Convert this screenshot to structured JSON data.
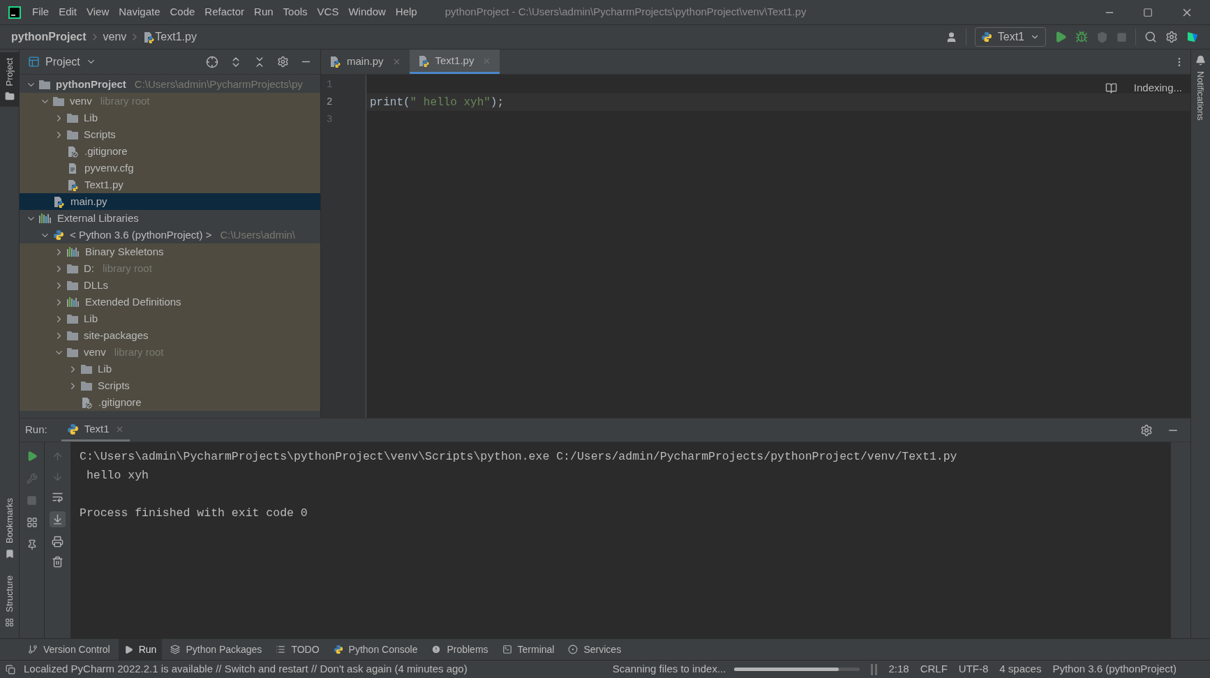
{
  "window": {
    "title": "pythonProject - C:\\Users\\admin\\PycharmProjects\\pythonProject\\venv\\Text1.py"
  },
  "menu": [
    "File",
    "Edit",
    "View",
    "Navigate",
    "Code",
    "Refactor",
    "Run",
    "Tools",
    "VCS",
    "Window",
    "Help"
  ],
  "breadcrumbs": [
    {
      "label": "pythonProject",
      "kind": "project"
    },
    {
      "label": "venv",
      "kind": "folder"
    },
    {
      "label": "Text1.py",
      "kind": "python"
    }
  ],
  "run_config": {
    "label": "Text1"
  },
  "side_labels": {
    "left_top": "Project",
    "left_middle": "Bookmarks",
    "left_bottom": "Structure",
    "right": "Notifications"
  },
  "project_panel": {
    "title": "Project",
    "tree": [
      {
        "label": "pythonProject",
        "bold": true,
        "hint": "C:\\Users\\admin\\PycharmProjects\\py",
        "kind": "folder",
        "tinted": false,
        "selected": false,
        "expanded": true,
        "children": [
          {
            "label": "venv",
            "hint": "library root",
            "kind": "folder",
            "tinted": true,
            "selected": false,
            "expanded": true,
            "children": [
              {
                "label": "Lib",
                "kind": "folder",
                "tinted": true,
                "selected": false,
                "expanded": false
              },
              {
                "label": "Scripts",
                "kind": "folder",
                "tinted": true,
                "selected": false,
                "expanded": false
              },
              {
                "label": ".gitignore",
                "kind": "ignore",
                "tinted": true,
                "selected": false
              },
              {
                "label": "pyvenv.cfg",
                "kind": "text",
                "tinted": true,
                "selected": false
              },
              {
                "label": "Text1.py",
                "kind": "python-file",
                "tinted": true,
                "selected": false
              }
            ]
          },
          {
            "label": "main.py",
            "kind": "python-file",
            "selected": true
          }
        ]
      },
      {
        "label": "External Libraries",
        "kind": "library",
        "tinted": false,
        "selected": false,
        "expanded": true,
        "children": [
          {
            "label": "< Python 3.6 (pythonProject) >",
            "hint": "C:\\Users\\admin\\",
            "kind": "python",
            "tinted": false,
            "selected": false,
            "expanded": true,
            "children": [
              {
                "label": "Binary Skeletons",
                "kind": "library",
                "tinted": true,
                "selected": false,
                "expanded": false
              },
              {
                "label": "D:",
                "hint": "library root",
                "kind": "folder",
                "tinted": true,
                "selected": false,
                "expanded": false
              },
              {
                "label": "DLLs",
                "kind": "folder",
                "tinted": true,
                "selected": false,
                "expanded": false
              },
              {
                "label": "Extended Definitions",
                "kind": "library",
                "tinted": true,
                "selected": false,
                "expanded": false
              },
              {
                "label": "Lib",
                "kind": "folder",
                "tinted": true,
                "selected": false,
                "expanded": false
              },
              {
                "label": "site-packages",
                "kind": "folder",
                "tinted": true,
                "selected": false,
                "expanded": false
              },
              {
                "label": "venv",
                "hint": "library root",
                "kind": "folder",
                "tinted": true,
                "selected": false,
                "expanded": true,
                "children": [
                  {
                    "label": "Lib",
                    "kind": "folder",
                    "tinted": true,
                    "selected": false,
                    "expanded": false
                  },
                  {
                    "label": "Scripts",
                    "kind": "folder",
                    "tinted": true,
                    "selected": false,
                    "expanded": false
                  },
                  {
                    "label": ".gitignore",
                    "kind": "ignore",
                    "tinted": true,
                    "selected": false
                  }
                ]
              }
            ]
          }
        ]
      }
    ]
  },
  "editor": {
    "tabs": [
      {
        "label": "main.py",
        "selected": false
      },
      {
        "label": "Text1.py",
        "selected": true
      }
    ],
    "status": "Indexing...",
    "lines": [
      {
        "number": "1",
        "current": false
      },
      {
        "number": "2",
        "current": true,
        "tokens": [
          {
            "text": "print(",
            "kind": "plain"
          },
          {
            "text": "\" hello xyh\"",
            "kind": "string"
          },
          {
            "text": ");",
            "kind": "plain"
          }
        ]
      },
      {
        "number": "3",
        "current": false
      }
    ]
  },
  "run_panel": {
    "label": "Run:",
    "tab": "Text1",
    "console": [
      {
        "text": "C:\\Users\\admin\\PycharmProjects\\pythonProject\\venv\\Scripts\\python.exe C:/Users/admin/PycharmProjects/pythonProject/venv/Text1.py",
        "kind": "command"
      },
      {
        "text": " hello xyh",
        "kind": "output"
      },
      {
        "text": "Process finished with exit code 0",
        "kind": "exit"
      }
    ]
  },
  "tool_tabs": [
    {
      "label": "Version Control",
      "selected": false
    },
    {
      "label": "Run",
      "selected": true
    },
    {
      "label": "Python Packages",
      "selected": false
    },
    {
      "label": "TODO",
      "selected": false
    },
    {
      "label": "Python Console",
      "selected": false
    },
    {
      "label": "Problems",
      "selected": false
    },
    {
      "label": "Terminal",
      "selected": false
    },
    {
      "label": "Services",
      "selected": false
    }
  ],
  "status_bar": {
    "message": "Localized PyCharm 2022.2.1 is available // Switch and restart // Don't ask again (4 minutes ago)",
    "progress_label": "Scanning files to index...",
    "level": 0.83,
    "items": [
      "2:18",
      "CRLF",
      "UTF-8",
      "4 spaces",
      "Python 3.6 (pythonProject)"
    ]
  }
}
